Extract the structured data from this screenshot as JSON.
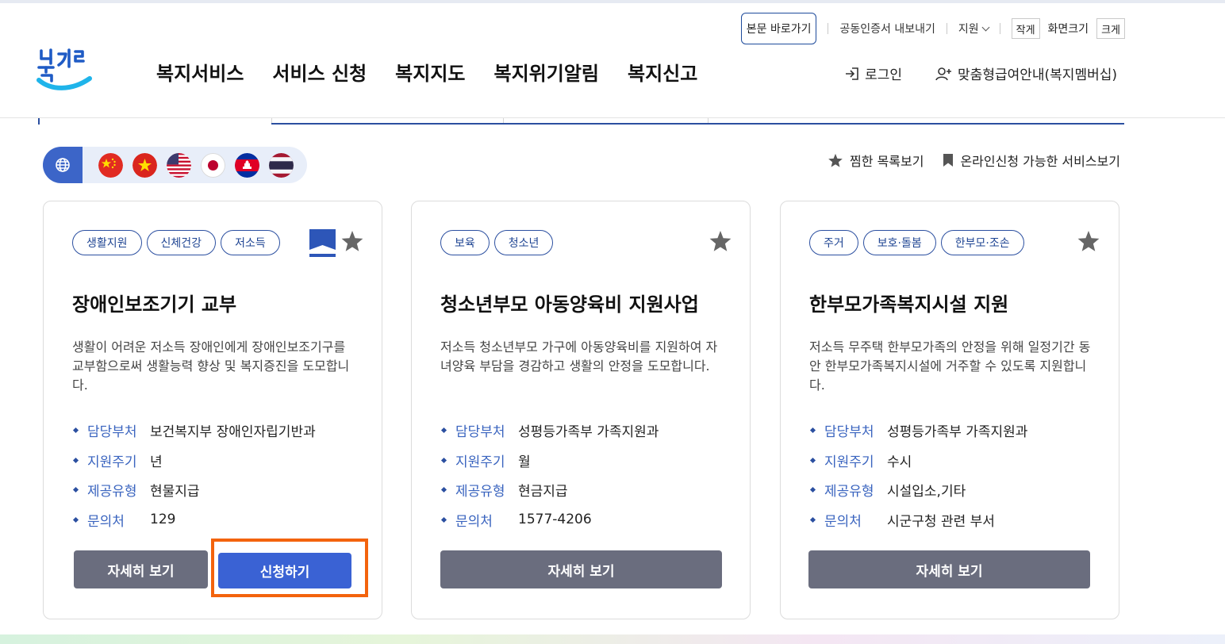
{
  "header": {
    "skip_to_content": "본문 바로가기",
    "cert_export": "공동인증서 내보내기",
    "support_menu": "지원",
    "font_small": "작게",
    "font_size_label": "화면크기",
    "font_large": "크게",
    "logo_text": "복지로",
    "gnb": [
      "복지서비스",
      "서비스 신청",
      "복지지도",
      "복지위기알림",
      "복지신고"
    ],
    "login": "로그인",
    "membership": "맞춤형급여안내(복지멤버십)"
  },
  "language_bar": {
    "globe_icon": "globe-icon",
    "flags": [
      "china-flag",
      "vietnam-flag",
      "usa-flag",
      "japan-flag",
      "cambodia-flag",
      "thailand-flag"
    ]
  },
  "top_links": {
    "wishlist": "찜한 목록보기",
    "online_services": "온라인신청 가능한 서비스보기"
  },
  "colors": {
    "brand_blue": "#2b4fa0",
    "button_blue": "#3a62d4",
    "button_gray": "#6a6d7e",
    "focus_orange": "#f3630d"
  },
  "cards": [
    {
      "tags": [
        "생활지원",
        "신체건강",
        "저소득"
      ],
      "bookmarked": true,
      "title": "장애인보조기기 교부",
      "description": "생활이 어려운 저소득 장애인에게 장애인보조기구를 교부함으로써 생활능력 향상 및 복지증진을 도모합니다.",
      "info": [
        {
          "label": "담당부처",
          "value": "보건복지부 장애인자립기반과"
        },
        {
          "label": "지원주기",
          "value": "년"
        },
        {
          "label": "제공유형",
          "value": "현물지급"
        },
        {
          "label": "문의처",
          "value": "129"
        }
      ],
      "detail_button": "자세히 보기",
      "apply_button": "신청하기"
    },
    {
      "tags": [
        "보육",
        "청소년"
      ],
      "bookmarked": false,
      "title": "청소년부모 아동양육비 지원사업",
      "description": "저소득 청소년부모 가구에 아동양육비를 지원하여 자녀양육 부담을 경감하고 생활의 안정을 도모합니다.",
      "info": [
        {
          "label": "담당부처",
          "value": "성평등가족부 가족지원과"
        },
        {
          "label": "지원주기",
          "value": "월"
        },
        {
          "label": "제공유형",
          "value": "현금지급"
        },
        {
          "label": "문의처",
          "value": "1577-4206"
        }
      ],
      "detail_button": "자세히 보기"
    },
    {
      "tags": [
        "주거",
        "보호·돌봄",
        "한부모·조손"
      ],
      "bookmarked": false,
      "title": "한부모가족복지시설 지원",
      "description": "저소득 무주택 한부모가족의 안정을 위해 일정기간 동안 한부모가족복지시설에 거주할 수 있도록 지원합니다.",
      "info": [
        {
          "label": "담당부처",
          "value": "성평등가족부 가족지원과"
        },
        {
          "label": "지원주기",
          "value": "수시"
        },
        {
          "label": "제공유형",
          "value": "시설입소,기타"
        },
        {
          "label": "문의처",
          "value": "시군구청 관련 부서"
        }
      ],
      "detail_button": "자세히 보기"
    }
  ]
}
